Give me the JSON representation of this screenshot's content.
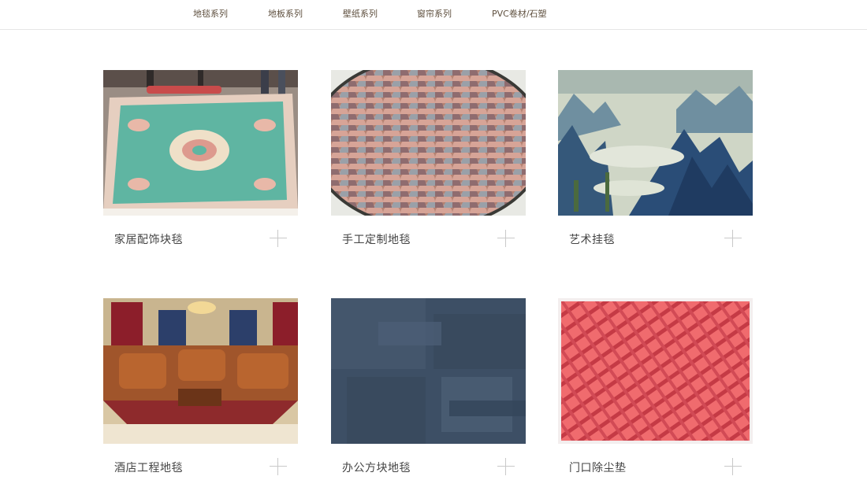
{
  "nav": {
    "items": [
      {
        "label": "地毯系列"
      },
      {
        "label": "地板系列"
      },
      {
        "label": "壁纸系列"
      },
      {
        "label": "窗帘系列"
      },
      {
        "label": "PVC卷材/石塑"
      }
    ]
  },
  "products": [
    {
      "title": "家居配饰块毯",
      "image": "persian-rug-photo"
    },
    {
      "title": "手工定制地毯",
      "image": "round-scale-pattern-rug-photo"
    },
    {
      "title": "艺术挂毯",
      "image": "mountain-landscape-tapestry-photo"
    },
    {
      "title": "酒店工程地毯",
      "image": "hotel-lobby-sofa-rug-photo"
    },
    {
      "title": "办公方块地毯",
      "image": "blue-carpet-tile-photo"
    },
    {
      "title": "门口除尘垫",
      "image": "red-entrance-mat-photo"
    }
  ],
  "colors": {
    "nav_text": "#5e4f3e",
    "caption_text": "#444444",
    "plus_icon": "#c9c9c9",
    "divider": "#e6e6e6"
  }
}
